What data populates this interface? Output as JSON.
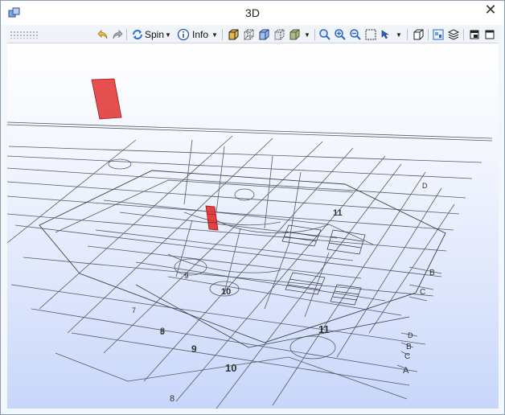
{
  "window": {
    "title": "3D",
    "close_glyph": "✕"
  },
  "toolbar": {
    "spin_label": "Spin",
    "info_label": "Info",
    "icons": [
      "undo-icon",
      "redo-icon",
      "spin-icon",
      "info-icon",
      "shaded-box-icon",
      "wireframe-box-icon",
      "hidden-line-box-icon",
      "dotted-box-icon",
      "solid-green-box-icon",
      "magnify-icon",
      "zoom-in-icon",
      "zoom-out-icon",
      "zoom-window-icon",
      "pan-pointer-icon",
      "parallel-projection-icon",
      "view-select-icon",
      "layers-icon",
      "restore-view-icon",
      "maximize-view-icon"
    ]
  },
  "scene": {
    "grid_labels": [
      "11",
      "10",
      "9",
      "8",
      "7",
      "11",
      "10",
      "9",
      "8",
      "8",
      "B",
      "C",
      "D",
      "A",
      "B",
      "C",
      "D"
    ],
    "colors": {
      "wire": "#555a64",
      "highlight": "#e03030",
      "bg_top": "#ffffff",
      "bg_bottom": "#c8d6fa"
    }
  }
}
